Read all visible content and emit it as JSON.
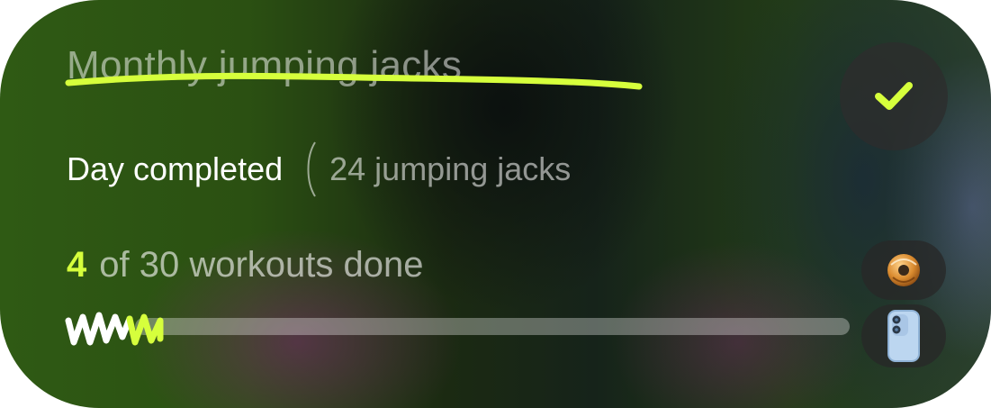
{
  "goal": {
    "title": "Monthly jumping jacks",
    "status": "Day completed",
    "detail": "24 jumping jacks"
  },
  "progress": {
    "done": "4",
    "label": "of 30 workouts done",
    "fraction": 0.133
  },
  "colors": {
    "accent": "#d6ff3c",
    "card_green": "#2f5a14"
  },
  "icons": {
    "complete": "checkmark-icon",
    "avatar_1": "donut-icon",
    "avatar_2": "phone-icon"
  }
}
